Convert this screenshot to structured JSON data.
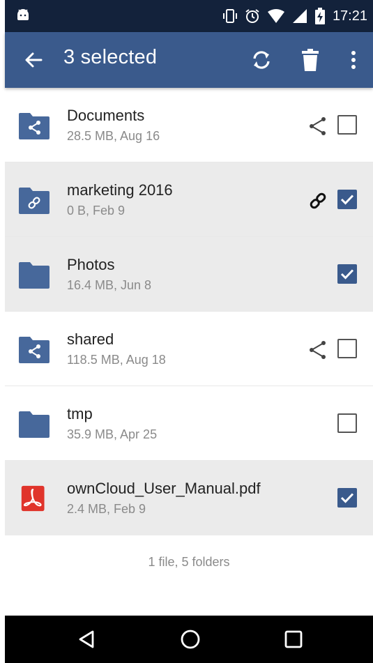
{
  "status_bar": {
    "time": "17:21",
    "icons": [
      "android-icon",
      "vibrate-icon",
      "alarm-icon",
      "wifi-icon",
      "signal-icon",
      "battery-charging-icon"
    ]
  },
  "app_bar": {
    "title": "3 selected",
    "actions": [
      "sync-icon",
      "trash-icon",
      "more-vert-icon"
    ],
    "color": "#3a5a8c"
  },
  "files": [
    {
      "name": "Documents",
      "meta": "28.5 MB, Aug 16",
      "type": "folder-shared",
      "status": "share-icon",
      "selected": false
    },
    {
      "name": "marketing 2016",
      "meta": "0 B, Feb 9",
      "type": "folder-link",
      "status": "link-icon",
      "selected": true
    },
    {
      "name": "Photos",
      "meta": "16.4 MB, Jun 8",
      "type": "folder",
      "status": "",
      "selected": true
    },
    {
      "name": "shared",
      "meta": "118.5 MB, Aug 18",
      "type": "folder-shared",
      "status": "share-icon",
      "selected": false
    },
    {
      "name": "tmp",
      "meta": "35.9 MB, Apr 25",
      "type": "folder",
      "status": "",
      "selected": false
    },
    {
      "name": "ownCloud_User_Manual.pdf",
      "meta": "2.4 MB, Feb 9",
      "type": "pdf",
      "status": "",
      "selected": true
    }
  ],
  "footer": {
    "summary": "1 file, 5 folders"
  },
  "nav_bar": {
    "buttons": [
      "back-triangle-icon",
      "home-circle-icon",
      "recents-square-icon"
    ]
  }
}
